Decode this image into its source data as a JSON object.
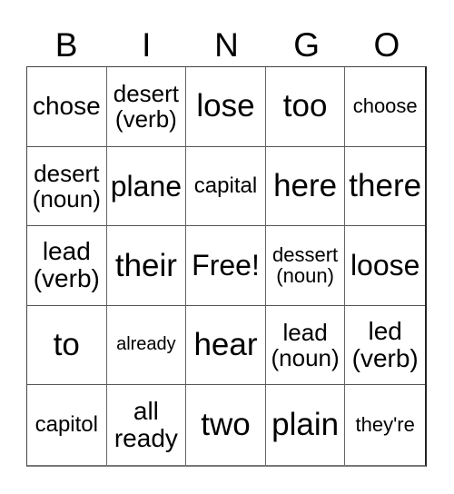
{
  "title_letters": [
    "B",
    "I",
    "N",
    "G",
    "O"
  ],
  "rows": [
    [
      "chose",
      "desert\n(verb)",
      "lose",
      "too",
      "choose"
    ],
    [
      "desert\n(noun)",
      "plane",
      "capital",
      "here",
      "there"
    ],
    [
      "lead\n(verb)",
      "their",
      "Free!",
      "dessert\n(noun)",
      "loose"
    ],
    [
      "to",
      "already",
      "hear",
      "lead\n(noun)",
      "led\n(verb)"
    ],
    [
      "capitol",
      "all\nready",
      "two",
      "plain",
      "they're"
    ]
  ]
}
